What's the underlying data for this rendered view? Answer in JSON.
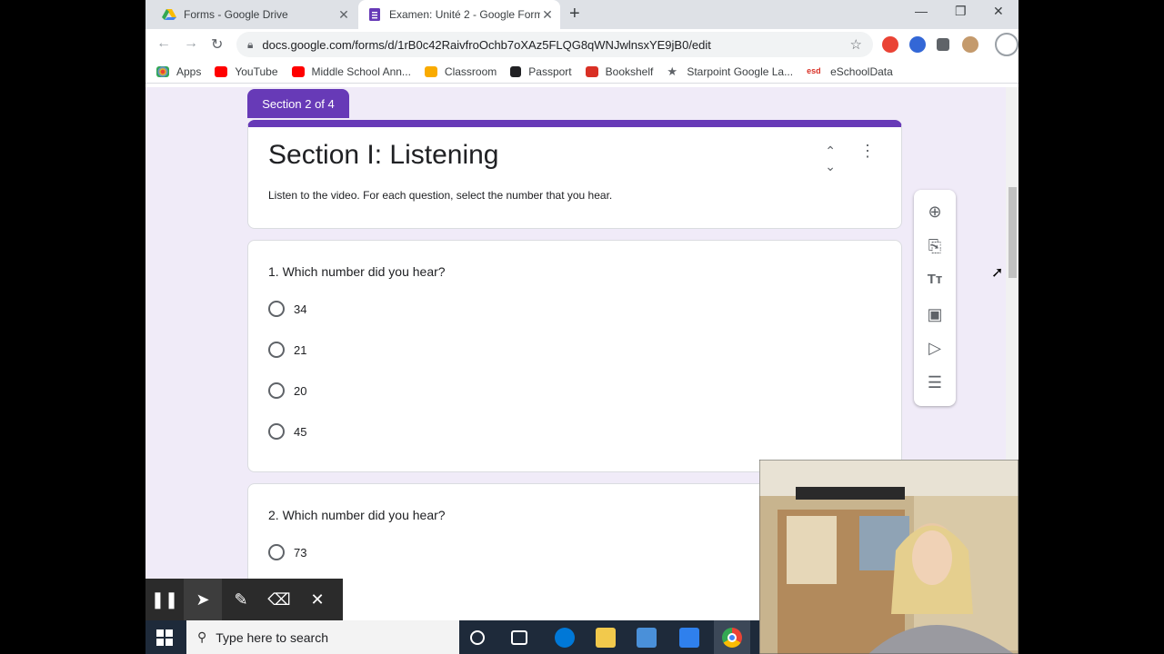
{
  "browser": {
    "tabs": [
      {
        "title": "Forms - Google Drive",
        "active": false
      },
      {
        "title": "Examen: Unité 2 - Google Forms",
        "active": true
      }
    ],
    "url": "docs.google.com/forms/d/1rB0c42RaivfroOchb7oXAz5FLQG8qWNJwlnsxYE9jB0/edit",
    "bookmarks": [
      "Apps",
      "YouTube",
      "Middle School Ann...",
      "Classroom",
      "Passport",
      "Bookshelf",
      "Starpoint Google La...",
      "eSchoolData"
    ]
  },
  "form": {
    "section_badge": "Section 2 of 4",
    "section_title": "Section I: Listening",
    "section_description": "Listen to the video. For each question, select the number that you hear.",
    "questions": [
      {
        "title": "1. Which number did you hear?",
        "options": [
          "34",
          "21",
          "20",
          "45"
        ]
      },
      {
        "title": "2. Which number did you hear?",
        "options": [
          "73"
        ]
      }
    ]
  },
  "sidebar_tools": [
    "add-question-icon",
    "import-questions-icon",
    "add-title-icon",
    "add-image-icon",
    "add-video-icon",
    "add-section-icon"
  ],
  "taskbar": {
    "search_placeholder": "Type here to search"
  },
  "colors": {
    "accent": "#673ab7",
    "background": "#f0ebf8"
  }
}
